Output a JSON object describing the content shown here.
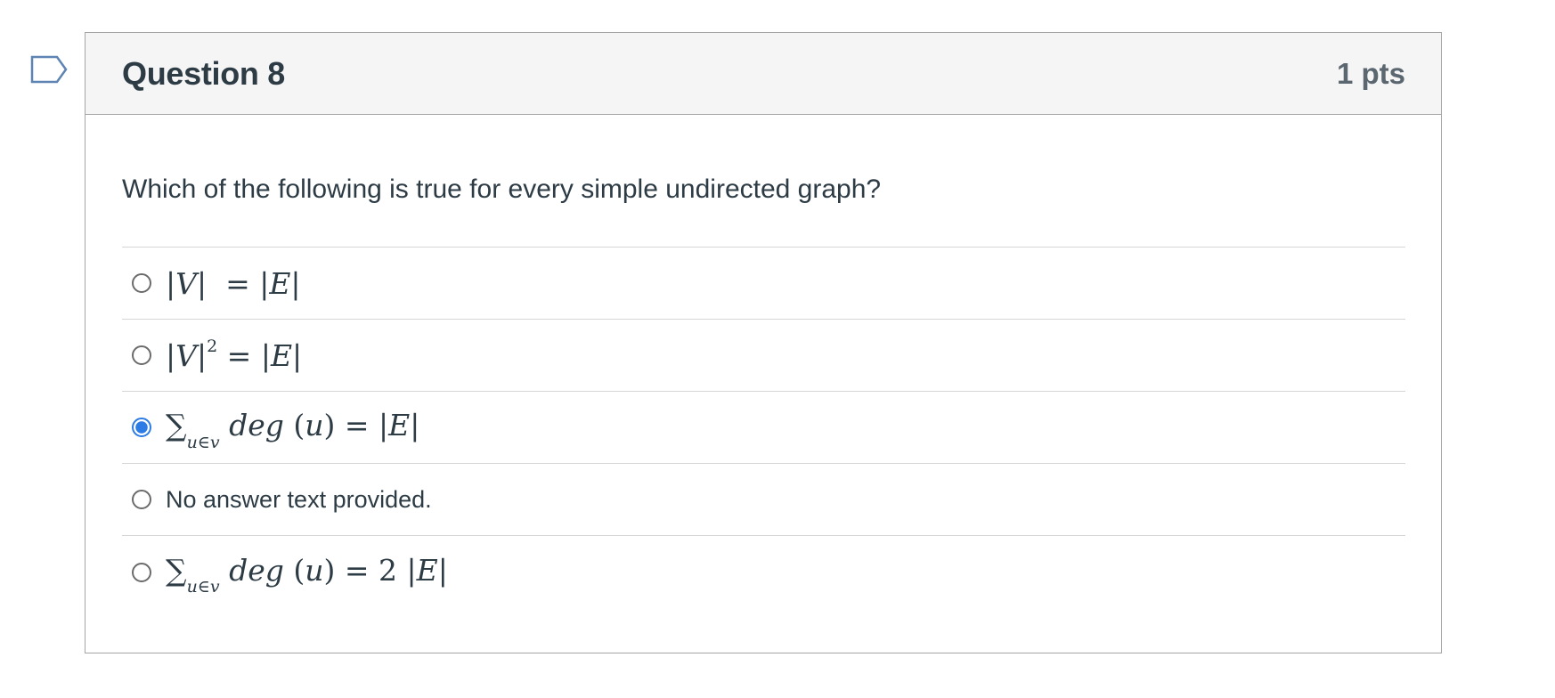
{
  "question": {
    "flag_icon": "flag-outline-icon",
    "title": "Question 8",
    "points": "1 pts",
    "prompt": "Which of the following is true for every simple undirected graph?"
  },
  "answers": [
    {
      "text": "|V|  = |E|",
      "selected": false
    },
    {
      "text": "|V|² = |E|",
      "selected": false
    },
    {
      "text": "∑u∈v deg (u) = |E|",
      "selected": true
    },
    {
      "text": "No answer text provided.",
      "selected": false
    },
    {
      "text": "∑u∈v deg (u) = 2 |E|",
      "selected": false
    }
  ],
  "colors": {
    "accent": "#2d7be5",
    "text": "#2d3b45",
    "header_bg": "#f5f5f5",
    "border": "#a5a5a5"
  }
}
